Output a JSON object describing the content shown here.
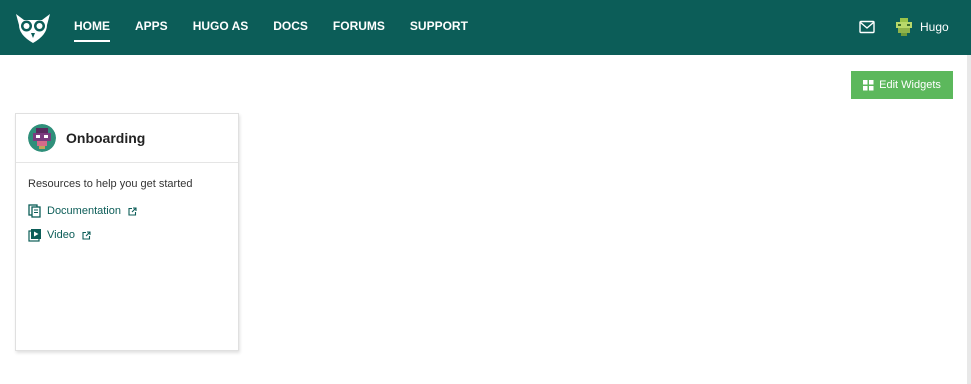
{
  "header": {
    "nav": [
      {
        "label": "HOME",
        "active": true
      },
      {
        "label": "APPS",
        "active": false
      },
      {
        "label": "HUGO AS",
        "active": false
      },
      {
        "label": "DOCS",
        "active": false
      },
      {
        "label": "FORUMS",
        "active": false
      },
      {
        "label": "SUPPORT",
        "active": false
      }
    ],
    "user_name": "Hugo",
    "icons": {
      "logo": "owl-logo-icon",
      "mail": "mail-icon",
      "avatar": "user-avatar"
    }
  },
  "toolbar": {
    "edit_widgets_label": "Edit Widgets"
  },
  "onboarding_card": {
    "title": "Onboarding",
    "description": "Resources to help you get started",
    "links": [
      {
        "label": "Documentation",
        "icon": "documents-icon"
      },
      {
        "label": "Video",
        "icon": "video-play-icon"
      }
    ]
  },
  "colors": {
    "header_bg": "#0c5d58",
    "button_green": "#5cb85c",
    "link_color": "#0c5d58"
  }
}
